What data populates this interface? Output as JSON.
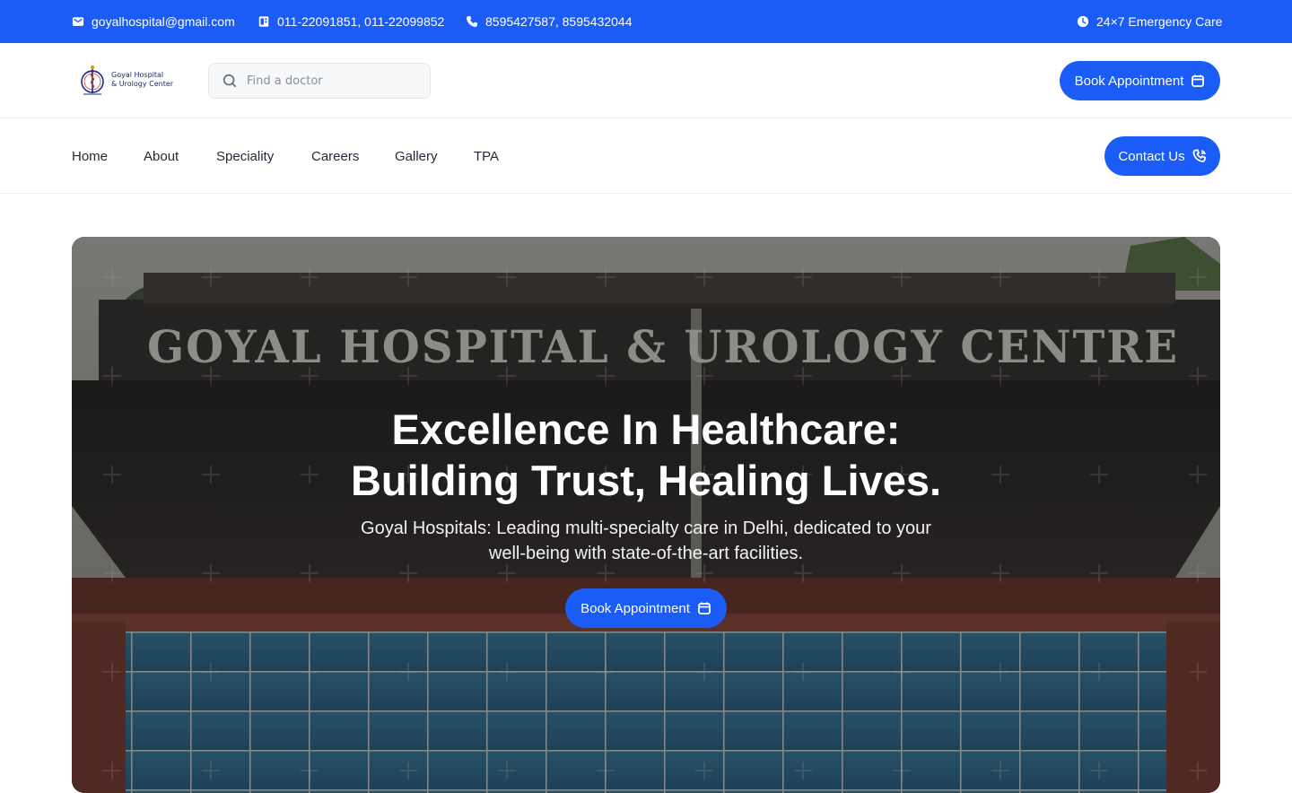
{
  "topbar": {
    "email": "goyalhospital@gmail.com",
    "landline": "011-22091851, 011-22099852",
    "mobile": "8595427587, 8595432044",
    "emergency": "24×7 Emergency Care"
  },
  "header": {
    "logo_line1": "Goyal Hospital",
    "logo_line2": "& Urology Center",
    "search_placeholder": "Find a doctor",
    "book_label": "Book Appointment"
  },
  "nav": {
    "items": [
      "Home",
      "About",
      "Speciality",
      "Careers",
      "Gallery",
      "TPA"
    ],
    "contact_label": "Contact Us"
  },
  "hero": {
    "title_line1": "Excellence In Healthcare:",
    "title_line2": "Building Trust, Healing Lives.",
    "subtitle_line1": "Goyal Hospitals: Leading multi-specialty care in Delhi, dedicated to your",
    "subtitle_line2": "well-being with state-of-the-art facilities.",
    "book_label": "Book Appointment",
    "building_sign": "GOYAL HOSPITAL & UROLOGY CENTRE"
  },
  "colors": {
    "brand": "#1a5cf5"
  }
}
